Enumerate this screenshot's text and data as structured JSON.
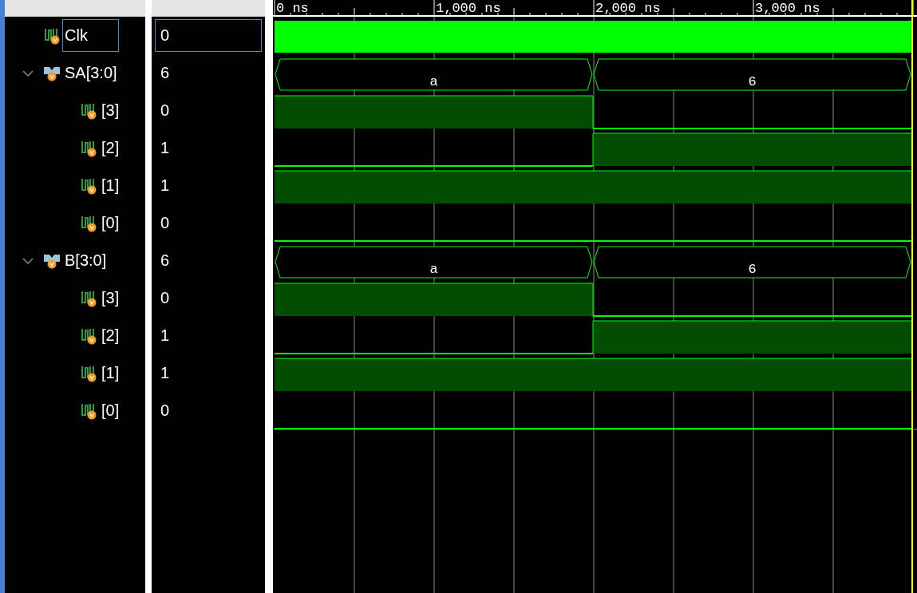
{
  "timeline": {
    "labels": [
      {
        "text": "0 ns"
      },
      {
        "text": "1,000 ns"
      },
      {
        "text": "2,000 ns"
      },
      {
        "text": "3,000 ns"
      }
    ]
  },
  "signals": [
    {
      "name": "Clk",
      "value": "0",
      "kind": "clock",
      "selected": true
    },
    {
      "name": "SA[3:0]",
      "value": "6",
      "kind": "bus",
      "selected": false,
      "expanded": true,
      "segments": [
        {
          "label": "a"
        },
        {
          "label": "6"
        }
      ],
      "children": [
        {
          "name": "[3]",
          "value": "0",
          "kind": "bit",
          "selected": false,
          "segments": [
            {
              "high": true
            },
            {
              "high": false
            }
          ]
        },
        {
          "name": "[2]",
          "value": "1",
          "kind": "bit",
          "selected": false,
          "segments": [
            {
              "high": false
            },
            {
              "high": true
            }
          ]
        },
        {
          "name": "[1]",
          "value": "1",
          "kind": "bit",
          "selected": false,
          "segments": [
            {
              "high": true
            },
            {
              "high": true
            }
          ]
        },
        {
          "name": "[0]",
          "value": "0",
          "kind": "bit",
          "selected": false,
          "segments": [
            {
              "high": false
            },
            {
              "high": false
            }
          ]
        }
      ]
    },
    {
      "name": "B[3:0]",
      "value": "6",
      "kind": "bus",
      "selected": false,
      "expanded": true,
      "segments": [
        {
          "label": "a"
        },
        {
          "label": "6"
        }
      ],
      "children": [
        {
          "name": "[3]",
          "value": "0",
          "kind": "bit",
          "selected": false,
          "segments": [
            {
              "high": true
            },
            {
              "high": false
            }
          ]
        },
        {
          "name": "[2]",
          "value": "1",
          "kind": "bit",
          "selected": false,
          "segments": [
            {
              "high": false
            },
            {
              "high": true
            }
          ]
        },
        {
          "name": "[1]",
          "value": "1",
          "kind": "bit",
          "selected": false,
          "segments": [
            {
              "high": true
            },
            {
              "high": true
            }
          ]
        },
        {
          "name": "[0]",
          "value": "0",
          "kind": "bit",
          "selected": false,
          "segments": [
            {
              "high": false
            },
            {
              "high": false
            }
          ]
        }
      ]
    }
  ]
}
